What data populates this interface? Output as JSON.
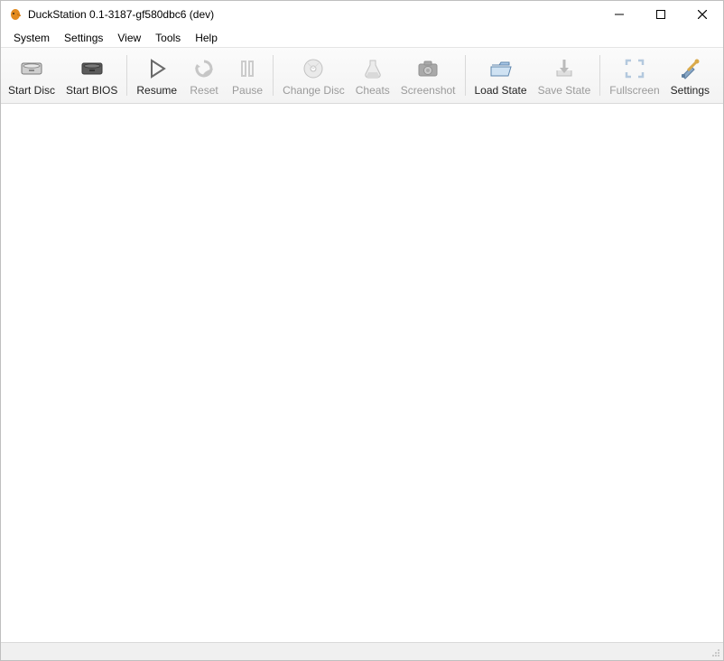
{
  "window": {
    "title": "DuckStation 0.1-3187-gf580dbc6 (dev)"
  },
  "menu": {
    "items": [
      "System",
      "Settings",
      "View",
      "Tools",
      "Help"
    ]
  },
  "toolbar": {
    "items": [
      {
        "id": "start-disc",
        "label": "Start Disc",
        "icon": "disc-drive-icon",
        "enabled": true
      },
      {
        "id": "start-bios",
        "label": "Start BIOS",
        "icon": "bios-drive-icon",
        "enabled": true
      },
      {
        "sep": true
      },
      {
        "id": "resume",
        "label": "Resume",
        "icon": "play-icon",
        "enabled": true
      },
      {
        "id": "reset",
        "label": "Reset",
        "icon": "refresh-icon",
        "enabled": false
      },
      {
        "id": "pause",
        "label": "Pause",
        "icon": "pause-icon",
        "enabled": false
      },
      {
        "sep": true
      },
      {
        "id": "change-disc",
        "label": "Change Disc",
        "icon": "disc-icon",
        "enabled": false
      },
      {
        "id": "cheats",
        "label": "Cheats",
        "icon": "flask-icon",
        "enabled": false
      },
      {
        "id": "screenshot",
        "label": "Screenshot",
        "icon": "camera-icon",
        "enabled": false
      },
      {
        "sep": true
      },
      {
        "id": "load-state",
        "label": "Load State",
        "icon": "folder-open-icon",
        "enabled": true
      },
      {
        "id": "save-state",
        "label": "Save State",
        "icon": "save-download-icon",
        "enabled": false
      },
      {
        "sep": true
      },
      {
        "id": "fullscreen",
        "label": "Fullscreen",
        "icon": "fullscreen-icon",
        "enabled": false
      },
      {
        "id": "settings",
        "label": "Settings",
        "icon": "tools-icon",
        "enabled": true
      }
    ]
  }
}
